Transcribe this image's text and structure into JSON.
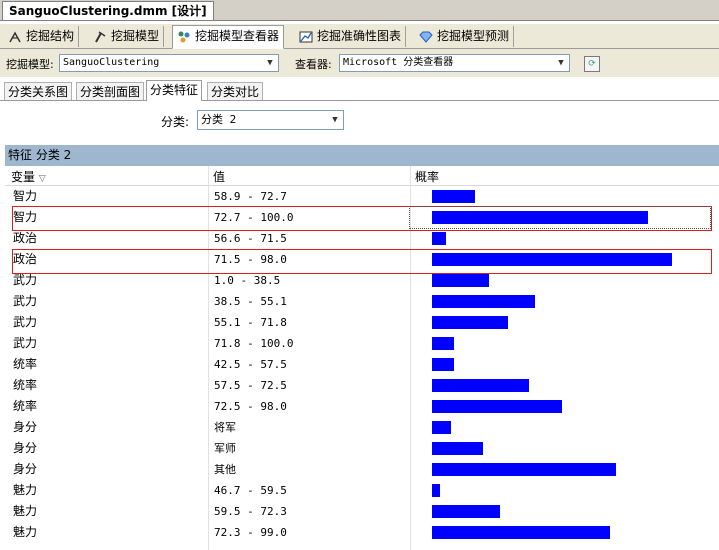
{
  "document_tab": "SanguoClustering.dmm [设计]",
  "main_tabs": [
    {
      "label": "挖掘结构",
      "icon": "mining-structure-icon"
    },
    {
      "label": "挖掘模型",
      "icon": "mining-model-icon"
    },
    {
      "label": "挖掘模型查看器",
      "icon": "model-viewer-icon"
    },
    {
      "label": "挖掘准确性图表",
      "icon": "accuracy-chart-icon"
    },
    {
      "label": "挖掘模型预测",
      "icon": "prediction-icon"
    }
  ],
  "toolbar": {
    "model_label": "挖掘模型:",
    "model_value": "SanguoClustering",
    "viewer_label": "查看器:",
    "viewer_value": "Microsoft 分类查看器"
  },
  "sub_tabs": [
    "分类关系图",
    "分类剖面图",
    "分类特征",
    "分类对比"
  ],
  "category": {
    "label": "分类:",
    "value": "分类 2"
  },
  "section_title": "特征 分类 2",
  "columns": {
    "variable": "变量",
    "value": "值",
    "probability": "概率"
  },
  "rows": [
    {
      "variable": "智力",
      "value": "58.9 - 72.7",
      "probability": 0.16
    },
    {
      "variable": "智力",
      "value": "72.7 - 100.0",
      "probability": 0.8
    },
    {
      "variable": "政治",
      "value": "56.6 - 71.5",
      "probability": 0.05
    },
    {
      "variable": "政治",
      "value": "71.5 - 98.0",
      "probability": 0.89
    },
    {
      "variable": "武力",
      "value": "1.0 - 38.5",
      "probability": 0.21
    },
    {
      "variable": "武力",
      "value": "38.5 - 55.1",
      "probability": 0.38
    },
    {
      "variable": "武力",
      "value": "55.1 - 71.8",
      "probability": 0.28
    },
    {
      "variable": "武力",
      "value": "71.8 - 100.0",
      "probability": 0.08
    },
    {
      "variable": "统率",
      "value": "42.5 - 57.5",
      "probability": 0.08
    },
    {
      "variable": "统率",
      "value": "57.5 - 72.5",
      "probability": 0.36
    },
    {
      "variable": "统率",
      "value": "72.5 - 98.0",
      "probability": 0.48
    },
    {
      "variable": "身分",
      "value": "将军",
      "probability": 0.07
    },
    {
      "variable": "身分",
      "value": "军师",
      "probability": 0.19
    },
    {
      "variable": "身分",
      "value": "其他",
      "probability": 0.68
    },
    {
      "variable": "魅力",
      "value": "46.7 - 59.5",
      "probability": 0.03
    },
    {
      "variable": "魅力",
      "value": "59.5 - 72.3",
      "probability": 0.25
    },
    {
      "variable": "魅力",
      "value": "72.3 - 99.0",
      "probability": 0.66
    }
  ],
  "colors": {
    "bar": "#0000ff",
    "highlight": "#d8201e",
    "section_header": "#9fb6cf"
  }
}
